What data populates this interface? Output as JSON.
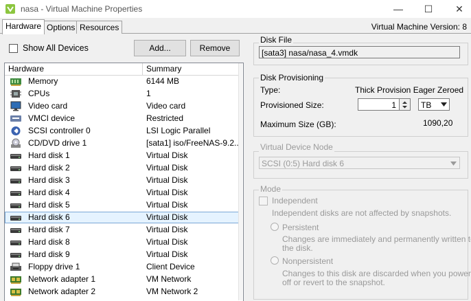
{
  "window": {
    "title": "nasa - Virtual Machine Properties",
    "minimize_glyph": "—",
    "maximize_glyph": "☐",
    "close_glyph": "✕"
  },
  "tabs": [
    {
      "label": "Hardware"
    },
    {
      "label": "Options"
    },
    {
      "label": "Resources"
    }
  ],
  "vm_version": "Virtual Machine Version: 8",
  "toolbar": {
    "show_all_label": "Show All Devices",
    "add_label": "Add...",
    "remove_label": "Remove"
  },
  "list": {
    "columns": [
      "Hardware",
      "Summary"
    ],
    "rows": [
      {
        "name": "Memory",
        "summary": "6144 MB",
        "icon": "memory-icon"
      },
      {
        "name": "CPUs",
        "summary": "1",
        "icon": "cpu-icon"
      },
      {
        "name": "Video card",
        "summary": "Video card",
        "icon": "monitor-icon"
      },
      {
        "name": "VMCI device",
        "summary": "Restricted",
        "icon": "vmci-icon"
      },
      {
        "name": "SCSI controller 0",
        "summary": "LSI Logic Parallel",
        "icon": "scsi-controller-icon"
      },
      {
        "name": "CD/DVD drive 1",
        "summary": "[sata1] iso/FreeNAS-9.2...",
        "icon": "cd-drive-icon"
      },
      {
        "name": "Hard disk 1",
        "summary": "Virtual Disk",
        "icon": "hard-disk-icon"
      },
      {
        "name": "Hard disk 2",
        "summary": "Virtual Disk",
        "icon": "hard-disk-icon"
      },
      {
        "name": "Hard disk 3",
        "summary": "Virtual Disk",
        "icon": "hard-disk-icon"
      },
      {
        "name": "Hard disk 4",
        "summary": "Virtual Disk",
        "icon": "hard-disk-icon"
      },
      {
        "name": "Hard disk 5",
        "summary": "Virtual Disk",
        "icon": "hard-disk-icon"
      },
      {
        "name": "Hard disk 6",
        "summary": "Virtual Disk",
        "icon": "hard-disk-icon",
        "selected": true
      },
      {
        "name": "Hard disk 7",
        "summary": "Virtual Disk",
        "icon": "hard-disk-icon"
      },
      {
        "name": "Hard disk 8",
        "summary": "Virtual Disk",
        "icon": "hard-disk-icon"
      },
      {
        "name": "Hard disk 9",
        "summary": "Virtual Disk",
        "icon": "hard-disk-icon"
      },
      {
        "name": "Floppy drive 1",
        "summary": "Client Device",
        "icon": "floppy-icon"
      },
      {
        "name": "Network adapter 1",
        "summary": "VM Network",
        "icon": "network-adapter-icon"
      },
      {
        "name": "Network adapter 2",
        "summary": "VM Network 2",
        "icon": "network-adapter-icon"
      }
    ]
  },
  "disk_file": {
    "title": "Disk File",
    "value": "[sata3] nasa/nasa_4.vmdk"
  },
  "disk_provisioning": {
    "title": "Disk Provisioning",
    "type_label": "Type:",
    "type_value": "Thick Provision Eager Zeroed",
    "size_label": "Provisioned Size:",
    "size_value": "1",
    "size_unit": "TB",
    "max_label": "Maximum Size (GB):",
    "max_value": "1090,20"
  },
  "vdn": {
    "title": "Virtual Device Node",
    "value": "SCSI (0:5) Hard disk 6"
  },
  "mode": {
    "title": "Mode",
    "independent_label": "Independent",
    "independent_desc": "Independent disks are not affected by snapshots.",
    "persistent_label": "Persistent",
    "persistent_desc_1": "Changes are immediately and permanently written to",
    "persistent_desc_2": "the disk.",
    "nonpersistent_label": "Nonpersistent",
    "nonpersistent_desc_1": "Changes to this disk are discarded when you power",
    "nonpersistent_desc_2": "off or revert to the snapshot."
  },
  "colors": {
    "selection": "#e5f3ff",
    "selection_border": "#7aa7d6",
    "disabled_text": "#9a9a9a"
  }
}
